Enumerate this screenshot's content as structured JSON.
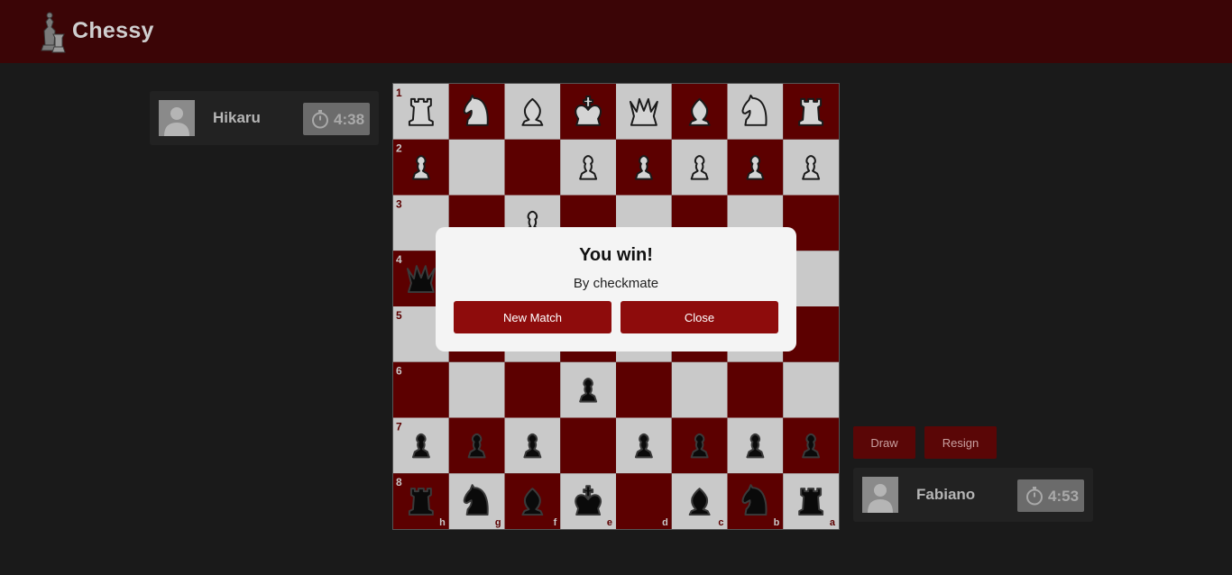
{
  "header": {
    "app_title": "Chessy",
    "logo_icon": "chess-pieces-logo-icon"
  },
  "opponent": {
    "name": "Hikaru",
    "time": "4:38",
    "avatar_icon": "person-avatar-icon",
    "timer_icon": "stopwatch-icon"
  },
  "player": {
    "name": "Fabiano",
    "time": "4:53",
    "avatar_icon": "person-avatar-icon",
    "timer_icon": "stopwatch-icon"
  },
  "actions": {
    "draw_label": "Draw",
    "resign_label": "Resign"
  },
  "modal": {
    "title": "You win!",
    "subtitle": "By checkmate",
    "new_match_label": "New Match",
    "close_label": "Close"
  },
  "board": {
    "colors": {
      "dark": "#5c0000",
      "light": "#c9c9c9",
      "white_piece": "#d4d4d4",
      "black_piece": "#0a0a0a"
    },
    "rank_labels": [
      "1",
      "2",
      "3",
      "4",
      "5",
      "6",
      "7",
      "8"
    ],
    "file_labels": [
      "h",
      "g",
      "f",
      "e",
      "d",
      "c",
      "b",
      "a"
    ],
    "pieces": [
      {
        "square": "h1",
        "type": "rook",
        "color": "white"
      },
      {
        "square": "g1",
        "type": "knight",
        "color": "white"
      },
      {
        "square": "f1",
        "type": "bishop",
        "color": "white"
      },
      {
        "square": "e1",
        "type": "king",
        "color": "white"
      },
      {
        "square": "d1",
        "type": "queen",
        "color": "white"
      },
      {
        "square": "c1",
        "type": "bishop",
        "color": "white"
      },
      {
        "square": "b1",
        "type": "knight",
        "color": "white"
      },
      {
        "square": "a1",
        "type": "rook",
        "color": "white"
      },
      {
        "square": "h2",
        "type": "pawn",
        "color": "white"
      },
      {
        "square": "e2",
        "type": "pawn",
        "color": "white"
      },
      {
        "square": "d2",
        "type": "pawn",
        "color": "white"
      },
      {
        "square": "c2",
        "type": "pawn",
        "color": "white"
      },
      {
        "square": "b2",
        "type": "pawn",
        "color": "white"
      },
      {
        "square": "a2",
        "type": "pawn",
        "color": "white"
      },
      {
        "square": "f3",
        "type": "pawn",
        "color": "white"
      },
      {
        "square": "h4",
        "type": "queen",
        "color": "black"
      },
      {
        "square": "e6",
        "type": "pawn",
        "color": "black"
      },
      {
        "square": "h7",
        "type": "pawn",
        "color": "black"
      },
      {
        "square": "g7",
        "type": "pawn",
        "color": "black"
      },
      {
        "square": "f7",
        "type": "pawn",
        "color": "black"
      },
      {
        "square": "d7",
        "type": "pawn",
        "color": "black"
      },
      {
        "square": "c7",
        "type": "pawn",
        "color": "black"
      },
      {
        "square": "b7",
        "type": "pawn",
        "color": "black"
      },
      {
        "square": "a7",
        "type": "pawn",
        "color": "black"
      },
      {
        "square": "h8",
        "type": "rook",
        "color": "black"
      },
      {
        "square": "g8",
        "type": "knight",
        "color": "black"
      },
      {
        "square": "f8",
        "type": "bishop",
        "color": "black"
      },
      {
        "square": "e8",
        "type": "king",
        "color": "black"
      },
      {
        "square": "c8",
        "type": "bishop",
        "color": "black"
      },
      {
        "square": "b8",
        "type": "knight",
        "color": "black"
      },
      {
        "square": "a8",
        "type": "rook",
        "color": "black"
      }
    ]
  }
}
